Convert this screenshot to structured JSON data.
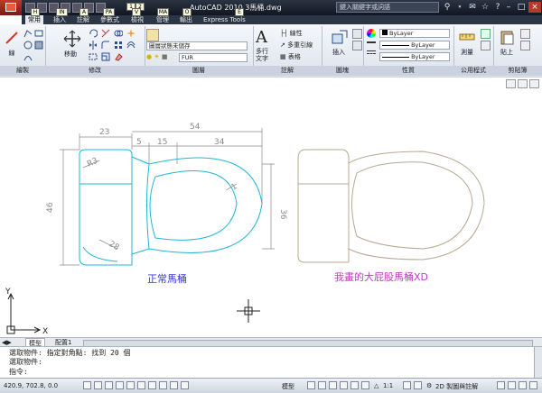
{
  "title_bar": {
    "window_title": "AutoCAD 2010    3馬桶.dwg",
    "search_placeholder": "鍵入關鍵字或詞語",
    "keytips": [
      "1",
      "2",
      "3",
      "4",
      "5",
      "6",
      "7"
    ]
  },
  "ribbon_tabs": [
    {
      "label": "常用",
      "key": "H"
    },
    {
      "label": "插入",
      "key": "IN"
    },
    {
      "label": "註解",
      "key": "A"
    },
    {
      "label": "參數式",
      "key": "PA"
    },
    {
      "label": "檢視",
      "key": "V"
    },
    {
      "label": "管理",
      "key": "MA"
    },
    {
      "label": "輸出",
      "key": "O"
    },
    {
      "label": "Express Tools",
      "key": "E"
    }
  ],
  "panels": {
    "draw": {
      "title": "繪製",
      "line_label": "線"
    },
    "modify": {
      "title": "修改",
      "move_label": "移動"
    },
    "layers": {
      "title": "圖層",
      "layer_state": "圖層狀態未儲存",
      "current_layer": "FUR"
    },
    "annotation": {
      "title": "註解",
      "text_label": "多行\n文字",
      "linear_label": "線性",
      "mleader_label": "多重引線",
      "table_label": "表格"
    },
    "block": {
      "title": "圖塊",
      "insert_label": "插入"
    },
    "properties": {
      "title": "性質",
      "color": "ByLayer",
      "linetype": "ByLayer",
      "lineweight": "ByLayer"
    },
    "utilities": {
      "title": "公用程式",
      "measure_label": "測量"
    },
    "clipboard": {
      "title": "剪貼簿",
      "paste_label": "貼上"
    }
  },
  "drawing": {
    "dims": {
      "d23": "23",
      "d54": "54",
      "d5": "5",
      "d15": "15",
      "d34": "34",
      "d46": "46",
      "d36": "36",
      "r53": "R3",
      "r28": "28",
      "r1": "1"
    },
    "label_normal": "正常馬桶",
    "label_mine": "我畫的大屁股馬桶XD",
    "ucs_x": "X",
    "ucs_y": "Y",
    "colors": {
      "cyan": "#1fb7d6",
      "grey_dim": "#8a8a8a",
      "blue_text": "#3a3adb",
      "magenta_text": "#cc33cc",
      "tan": "#b8a890"
    }
  },
  "layout_tabs": [
    "模型",
    "配置1"
  ],
  "command": {
    "line1": "選取物件: 指定對角點: 找到 20 個",
    "line2": "選取物件:",
    "prompt": "指令:"
  },
  "status": {
    "coords": "420.9, 702.8, 0.0",
    "space": "模型",
    "scale": "1:1",
    "workspace": "2D 製圖與註解"
  }
}
